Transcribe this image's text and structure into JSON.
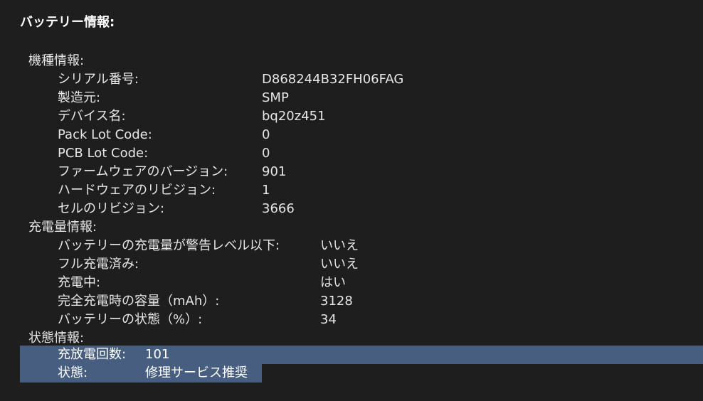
{
  "title": "バッテリー情報:",
  "model_info": {
    "heading": "機種情報:",
    "rows": [
      {
        "label": "シリアル番号:",
        "value": "D868244B32FH06FAG"
      },
      {
        "label": "製造元:",
        "value": "SMP"
      },
      {
        "label": "デバイス名:",
        "value": "bq20z451"
      },
      {
        "label": "Pack Lot Code:",
        "value": "0"
      },
      {
        "label": "PCB Lot Code:",
        "value": "0"
      },
      {
        "label": "ファームウェアのバージョン:",
        "value": "901"
      },
      {
        "label": "ハードウェアのリビジョン:",
        "value": "1"
      },
      {
        "label": "セルのリビジョン:",
        "value": "3666"
      }
    ]
  },
  "charge_info": {
    "heading": "充電量情報:",
    "rows": [
      {
        "label": "バッテリーの充電量が警告レベル以下:",
        "value": "いいえ"
      },
      {
        "label": "フル充電済み:",
        "value": "いいえ"
      },
      {
        "label": "充電中:",
        "value": "はい"
      },
      {
        "label": "完全充電時の容量（mAh）:",
        "value": "3128"
      },
      {
        "label": "バッテリーの状態（%）:",
        "value": "34"
      }
    ]
  },
  "status_info": {
    "heading": "状態情報:",
    "rows": [
      {
        "label": "充放電回数:",
        "value": "101"
      },
      {
        "label": "状態:",
        "value": "修理サービス推奨"
      }
    ]
  }
}
